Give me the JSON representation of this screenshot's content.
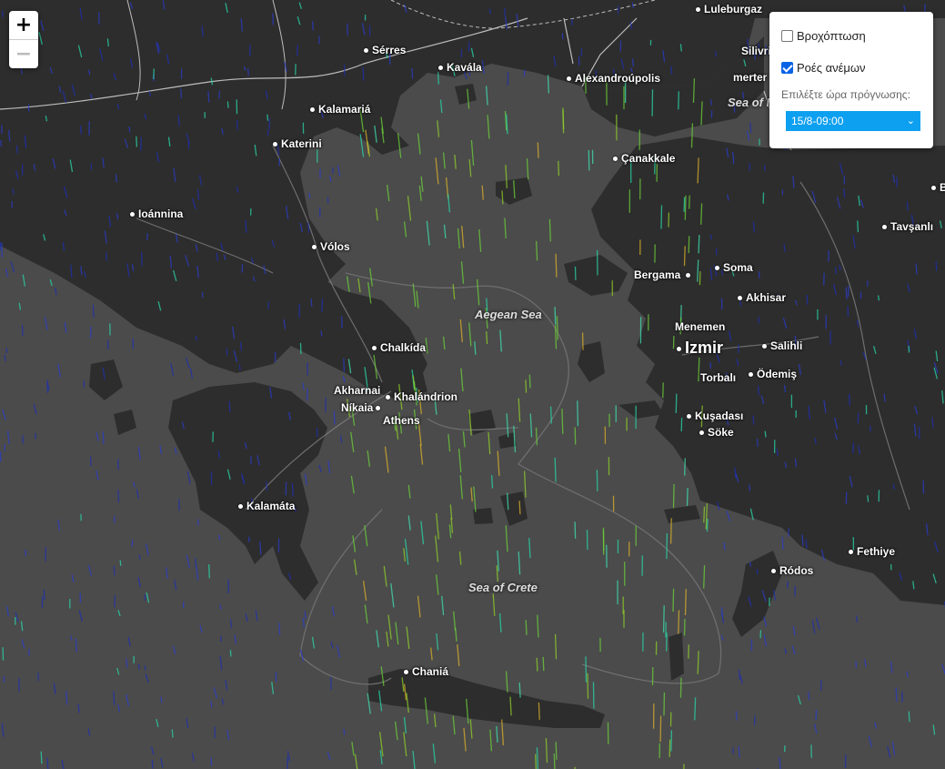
{
  "map": {
    "zoom_in": "+",
    "zoom_out": "−",
    "seas": [
      {
        "id": "aegean",
        "label": "Aegean Sea"
      },
      {
        "id": "crete",
        "label": "Sea of Crete"
      },
      {
        "id": "marmara",
        "label": "Sea of M"
      }
    ],
    "cities": [
      {
        "id": "luleburgaz",
        "label": "Luleburgaz"
      },
      {
        "id": "silivri",
        "label": "Silivri"
      },
      {
        "id": "merter",
        "label": "merter"
      },
      {
        "id": "serres",
        "label": "Sérres"
      },
      {
        "id": "kavala",
        "label": "Kavála"
      },
      {
        "id": "alexandroupolis",
        "label": "Alexandroúpolis"
      },
      {
        "id": "kalamaria",
        "label": "Kalamariá"
      },
      {
        "id": "katerini",
        "label": "Katerini"
      },
      {
        "id": "canakkale",
        "label": "Çanakkale"
      },
      {
        "id": "ioannina",
        "label": "Ioánnina"
      },
      {
        "id": "volos",
        "label": "Vólos"
      },
      {
        "id": "tavsanli",
        "label": "Tavşanlı"
      },
      {
        "id": "bergama",
        "label": "Bergama"
      },
      {
        "id": "soma",
        "label": "Soma"
      },
      {
        "id": "akhisar",
        "label": "Akhisar"
      },
      {
        "id": "menemen",
        "label": "Menemen"
      },
      {
        "id": "izmir",
        "label": "Izmir"
      },
      {
        "id": "salihli",
        "label": "Salihli"
      },
      {
        "id": "torbali",
        "label": "Torbalı"
      },
      {
        "id": "odemis",
        "label": "Ödemiş"
      },
      {
        "id": "chalkida",
        "label": "Chalkída"
      },
      {
        "id": "akharnai",
        "label": "Akharnai"
      },
      {
        "id": "khalandrion",
        "label": "Khalándrion"
      },
      {
        "id": "nikaia",
        "label": "Níkaia"
      },
      {
        "id": "athens",
        "label": "Athens"
      },
      {
        "id": "kusadasi",
        "label": "Kuşadası"
      },
      {
        "id": "soke",
        "label": "Söke"
      },
      {
        "id": "kalamata",
        "label": "Kalamáta"
      },
      {
        "id": "fethiye",
        "label": "Fethiye"
      },
      {
        "id": "rodos",
        "label": "Ródos"
      },
      {
        "id": "chania",
        "label": "Chaniá"
      },
      {
        "id": "b_edge",
        "label": "B"
      }
    ]
  },
  "controls": {
    "rain_label": "Βροχόπτωση",
    "rain_checked": false,
    "wind_label": "Ροές ανέμων",
    "wind_checked": true,
    "forecast_label": "Επιλέξτε ώρα πρόγνωσης:",
    "forecast_value": "15/8-09:00",
    "chevron_icon": "chevron-down-icon"
  },
  "colors": {
    "land": "#2e2e2e",
    "sea": "#4a4a4a",
    "select_bg": "#0ea0f0",
    "checkbox": "#0a63e6"
  }
}
